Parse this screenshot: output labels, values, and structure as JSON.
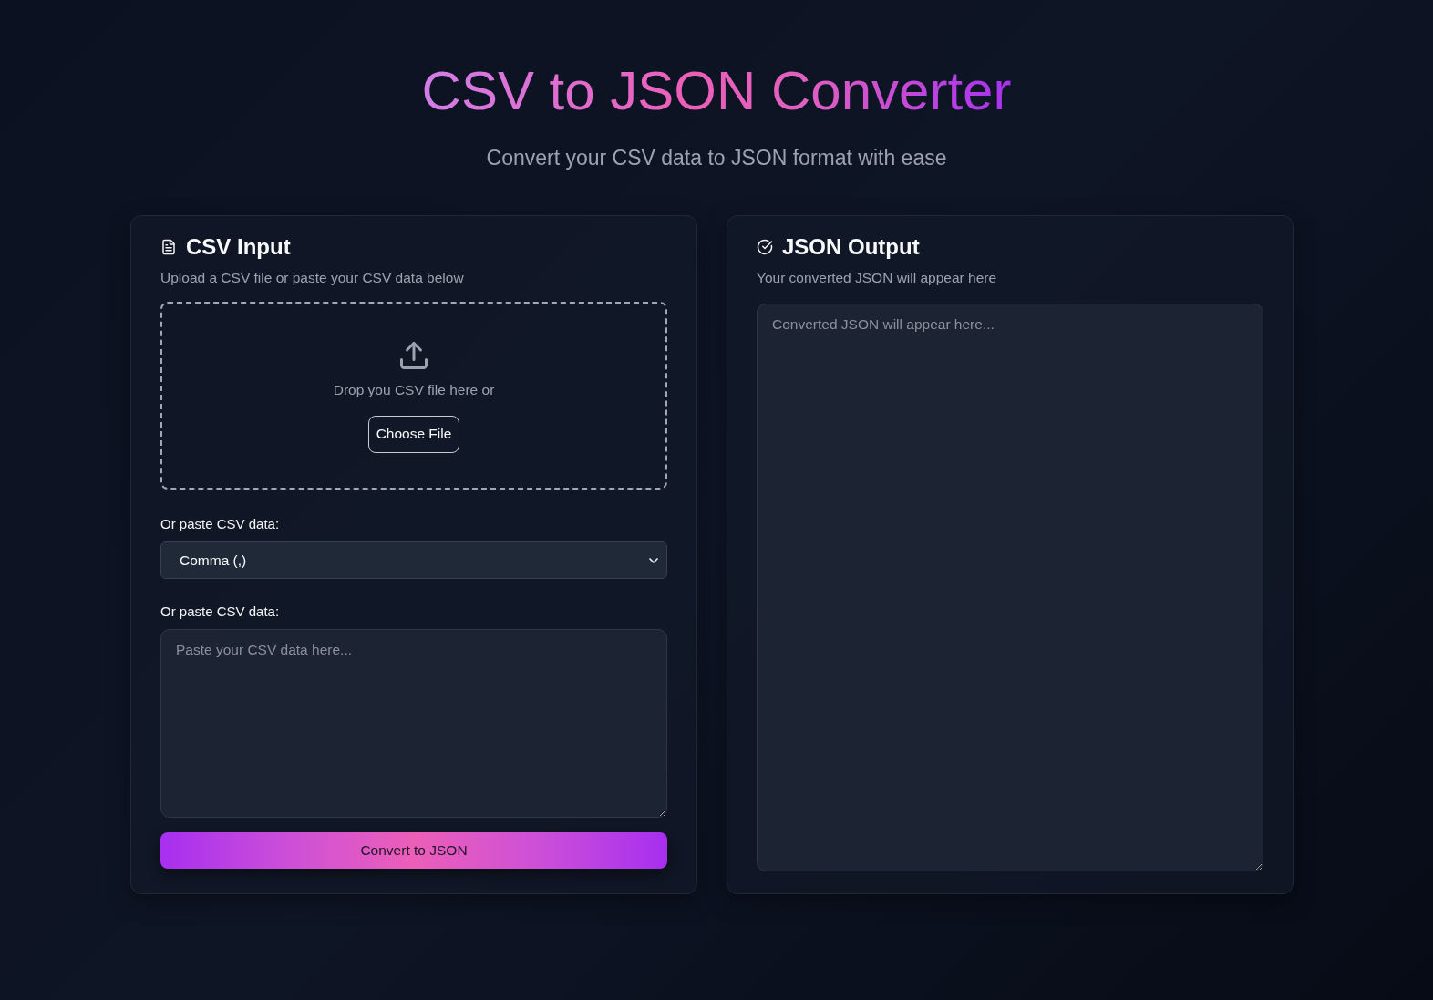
{
  "header": {
    "title": "CSV to JSON Converter",
    "subtitle": "Convert your CSV data to JSON format with ease"
  },
  "input_panel": {
    "title": "CSV Input",
    "description": "Upload a CSV file or paste your CSV data below",
    "dropzone": {
      "text": "Drop you CSV file here or",
      "button": "Choose File"
    },
    "delimiter": {
      "label": "Or paste CSV data:",
      "value": "Comma (,)"
    },
    "csv_data": {
      "label": "Or paste CSV data:",
      "placeholder": "Paste your CSV data here..."
    },
    "convert_button": "Convert to JSON"
  },
  "output_panel": {
    "title": "JSON Output",
    "description": "Your converted JSON will appear here",
    "output": {
      "placeholder": "Converted JSON will appear here..."
    }
  }
}
